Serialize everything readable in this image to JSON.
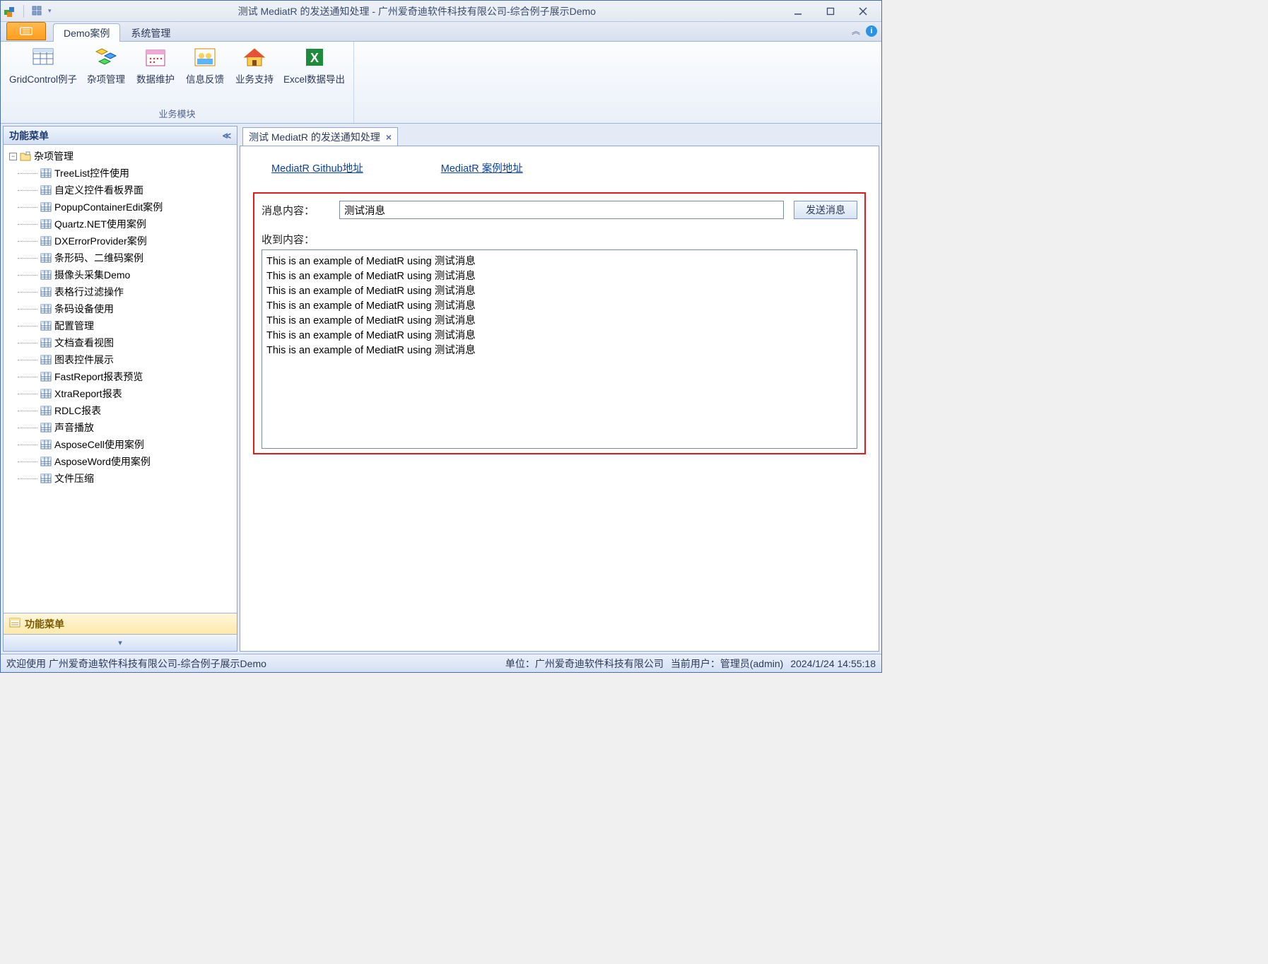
{
  "window": {
    "title": "测试 MediatR 的发送通知处理 - 广州爱奇迪软件科技有限公司-综合例子展示Demo"
  },
  "ribbon": {
    "tabs": [
      {
        "label": "Demo案例",
        "active": true
      },
      {
        "label": "系统管理",
        "active": false
      }
    ],
    "items": [
      {
        "label": "GridControl例子"
      },
      {
        "label": "杂项管理"
      },
      {
        "label": "数据维护"
      },
      {
        "label": "信息反馈"
      },
      {
        "label": "业务支持"
      },
      {
        "label": "Excel数据导出"
      }
    ],
    "group_name": "业务模块"
  },
  "sidebar": {
    "title": "功能菜单",
    "root": "杂项管理",
    "items": [
      "TreeList控件使用",
      "自定义控件看板界面",
      "PopupContainerEdit案例",
      "Quartz.NET使用案例",
      "DXErrorProvider案例",
      "条形码、二维码案例",
      "摄像头采集Demo",
      "表格行过滤操作",
      "条码设备使用",
      "配置管理",
      "文档查看视图",
      "图表控件展示",
      "FastReport报表预览",
      "XtraReport报表",
      "RDLC报表",
      "声音播放",
      "AsposeCell使用案例",
      "AsposeWord使用案例",
      "文件压缩"
    ],
    "bottom_title": "功能菜单"
  },
  "doc": {
    "tab_title": "测试 MediatR 的发送通知处理",
    "link_github": "MediatR Github地址",
    "link_sample": "MediatR 案例地址",
    "msg_label": "消息内容：",
    "msg_value": "测试消息",
    "send_btn": "发送消息",
    "recv_label": "收到内容：",
    "output_line": "This is an example of MediatR using 测试消息",
    "output_count": 7
  },
  "status": {
    "welcome": "欢迎使用 广州爱奇迪软件科技有限公司-综合例子展示Demo",
    "company": "单位：广州爱奇迪软件科技有限公司",
    "user": "当前用户：管理员(admin)",
    "time": "2024/1/24 14:55:18"
  }
}
